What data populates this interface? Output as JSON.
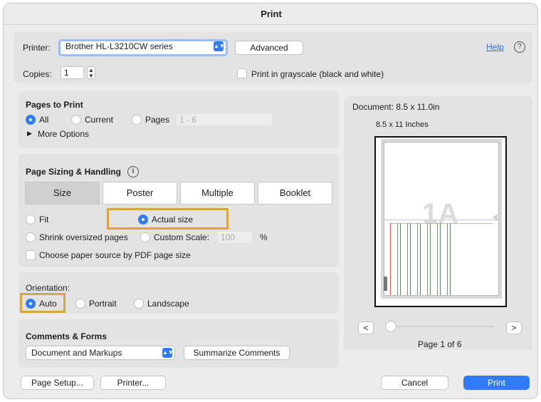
{
  "window": {
    "title": "Print"
  },
  "printer_row": {
    "printer_label": "Printer:",
    "printer_value": "Brother HL-L3210CW series",
    "advanced_label": "Advanced",
    "help_label": "Help",
    "help_icon": "?",
    "copies_label": "Copies:",
    "copies_value": "1",
    "grayscale_label": "Print in grayscale (black and white)"
  },
  "pages_to_print": {
    "title": "Pages to Print",
    "options": {
      "all": "All",
      "current": "Current",
      "pages": "Pages"
    },
    "pages_placeholder": "1 - 6",
    "more_options": "More Options",
    "selected": "All"
  },
  "page_sizing": {
    "title": "Page Sizing & Handling",
    "info_icon": "i",
    "tabs": [
      "Size",
      "Poster",
      "Multiple",
      "Booklet"
    ],
    "selected_tab": "Size",
    "fit_label": "Fit",
    "actual_size_label": "Actual size",
    "shrink_label": "Shrink oversized pages",
    "custom_scale_label": "Custom Scale:",
    "custom_scale_value": "100",
    "percent": "%",
    "paper_source_label": "Choose paper source by PDF page size",
    "selected": "Actual size"
  },
  "orientation": {
    "title": "Orientation:",
    "auto": "Auto",
    "portrait": "Portrait",
    "landscape": "Landscape",
    "selected": "Auto"
  },
  "comments": {
    "title": "Comments & Forms",
    "value": "Document and Markups",
    "summarize_label": "Summarize Comments"
  },
  "preview": {
    "document_size": "Document: 8.5 x 11.0in",
    "paper_label": "8.5 x 11 Inches",
    "page_mark": "1A",
    "prev": "<",
    "next": ">",
    "page_indicator": "Page 1 of 6",
    "slider_position": 0
  },
  "footer": {
    "page_setup": "Page Setup...",
    "printer": "Printer...",
    "cancel": "Cancel",
    "print": "Print"
  },
  "colors": {
    "accent": "#2f7cf6",
    "highlight": "#d9a441"
  }
}
